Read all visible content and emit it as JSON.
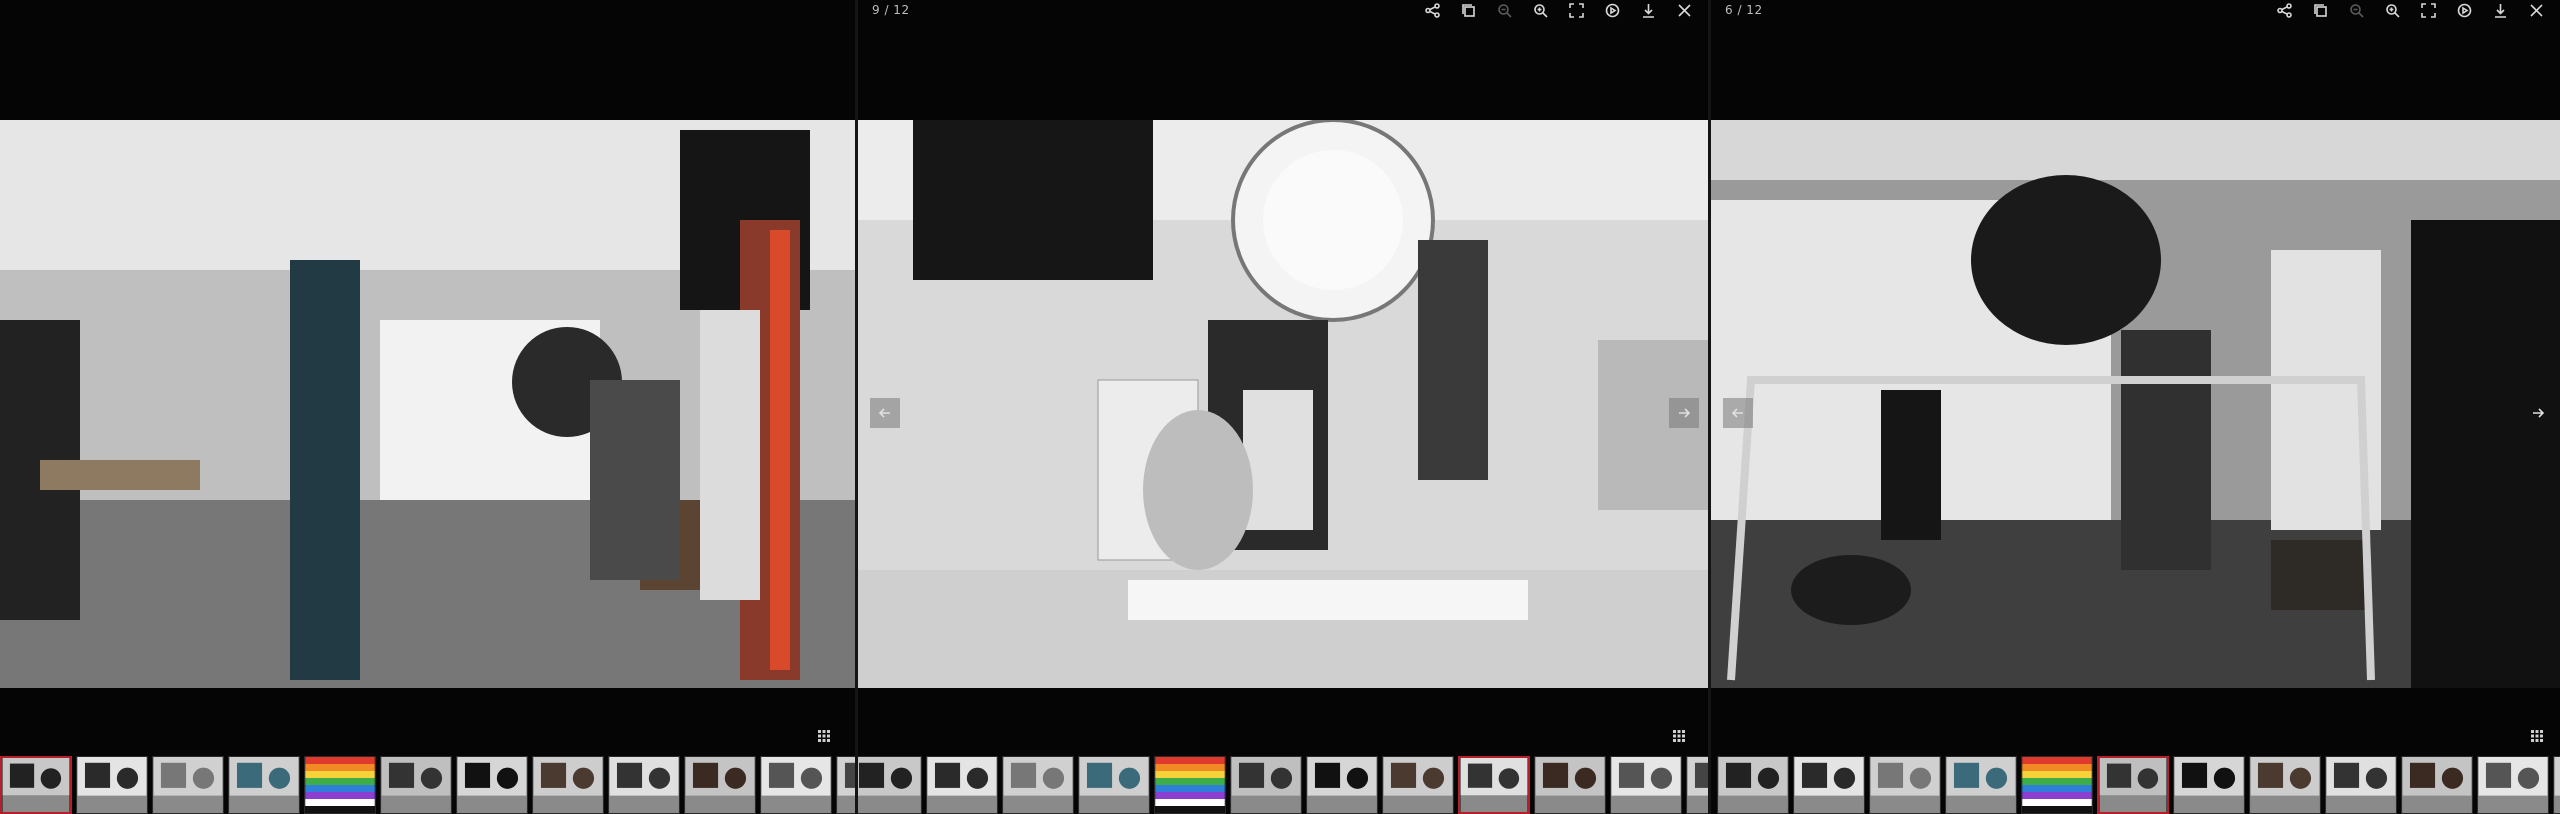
{
  "viewer": {
    "panes": [
      {
        "id": "left",
        "counter": "",
        "show_toolbar": false,
        "show_prev": false,
        "show_next": false,
        "active_thumb": 0
      },
      {
        "id": "middle",
        "counter": "9 / 12",
        "show_toolbar": true,
        "show_prev": true,
        "show_next": true,
        "active_thumb": 8
      },
      {
        "id": "right",
        "counter": "6 / 12",
        "show_toolbar": true,
        "show_prev": true,
        "show_next": true,
        "active_thumb": 5
      }
    ],
    "toolbar": [
      {
        "name": "share-icon",
        "enabled": true
      },
      {
        "name": "copy-icon",
        "enabled": true
      },
      {
        "name": "zoom-out-icon",
        "enabled": false
      },
      {
        "name": "zoom-in-icon",
        "enabled": true
      },
      {
        "name": "fullscreen-icon",
        "enabled": true
      },
      {
        "name": "play-icon",
        "enabled": true
      },
      {
        "name": "download-icon",
        "enabled": true
      },
      {
        "name": "close-icon",
        "enabled": true
      }
    ],
    "thumbnails_count": 12,
    "colors": {
      "background": "#050505",
      "active_border": "#b41f2a"
    }
  }
}
